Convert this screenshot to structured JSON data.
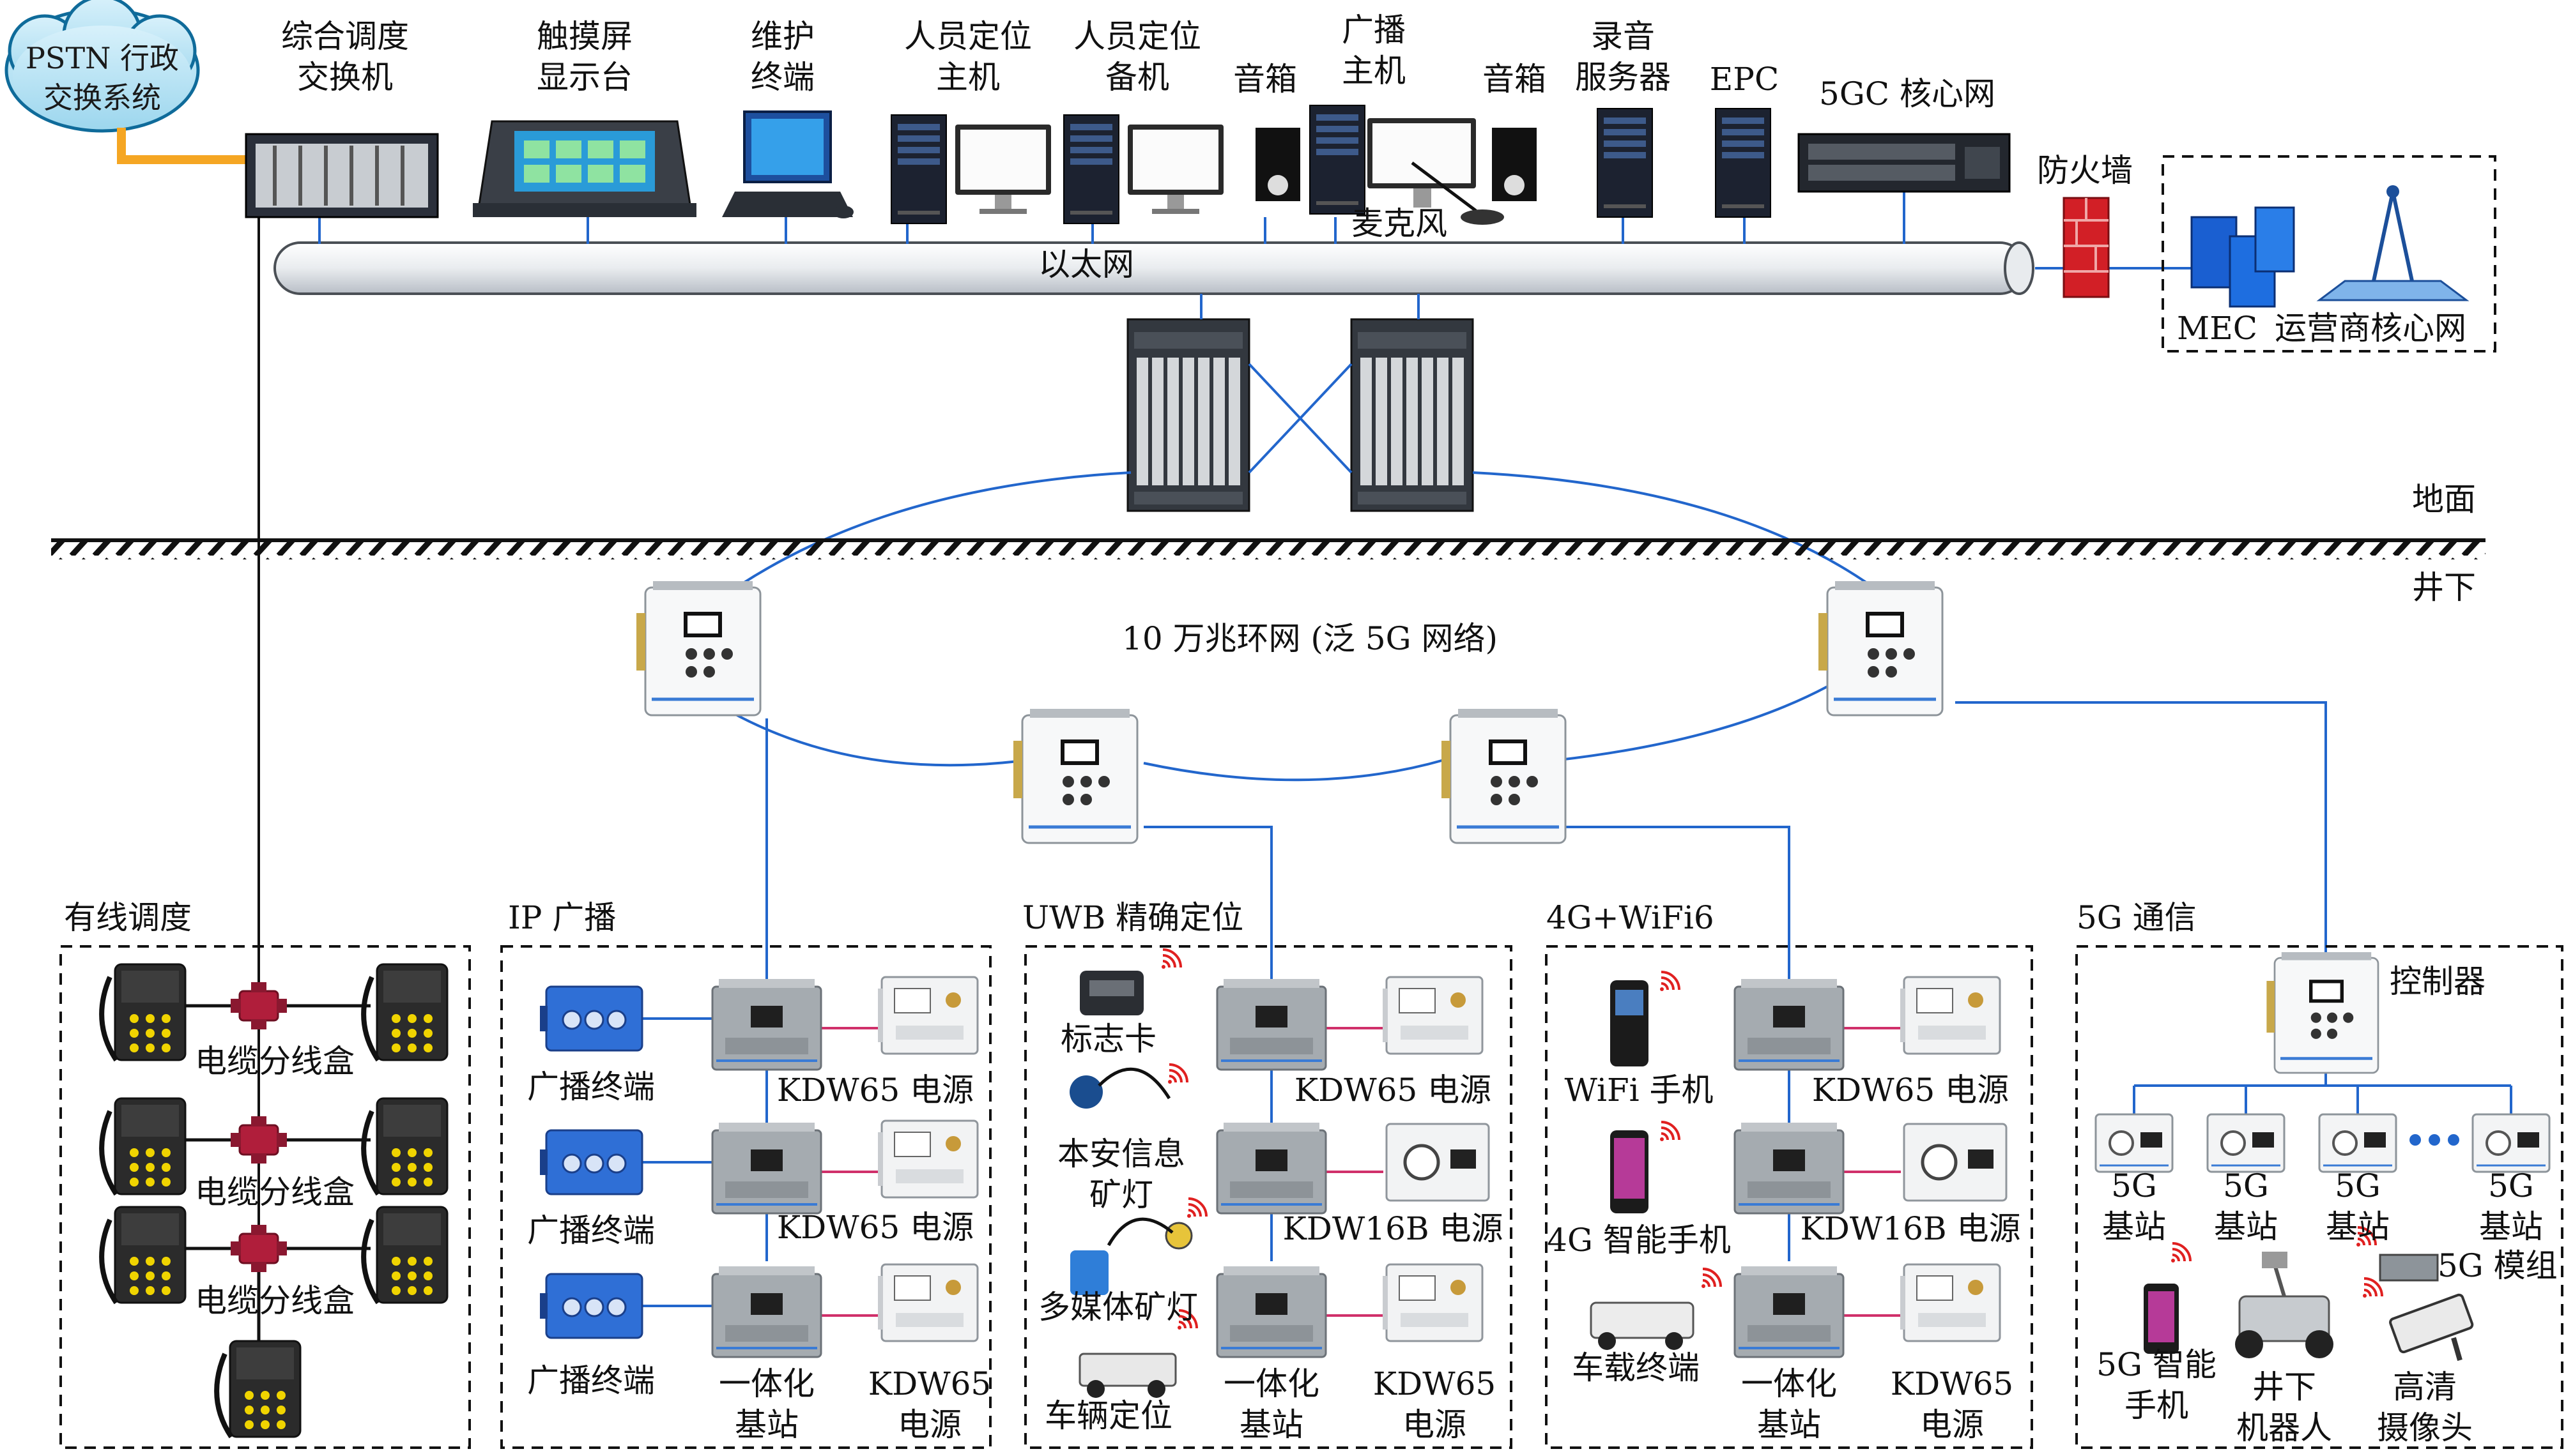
{
  "cloud": {
    "line1": "PSTN 行政",
    "line2": "交换系统"
  },
  "top_devices": [
    {
      "key": "switchboard",
      "line1": "综合调度",
      "line2": "交换机"
    },
    {
      "key": "touchscreen",
      "line1": "触摸屏",
      "line2": "显示台"
    },
    {
      "key": "maintenance",
      "line1": "维护",
      "line2": "终端"
    },
    {
      "key": "pos-main",
      "line1": "人员定位",
      "line2": "主机"
    },
    {
      "key": "pos-backup",
      "line1": "人员定位",
      "line2": "备机"
    },
    {
      "key": "speaker-left",
      "line1": "音箱",
      "line2": ""
    },
    {
      "key": "broadcast-host",
      "line1": "广播",
      "line2": "主机"
    },
    {
      "key": "speaker-right",
      "line1": "音箱",
      "line2": ""
    },
    {
      "key": "recording",
      "line1": "录音",
      "line2": "服务器"
    },
    {
      "key": "epc",
      "line1": "EPC",
      "line2": ""
    },
    {
      "key": "core5gc",
      "line1": "5GC 核心网",
      "line2": ""
    }
  ],
  "labels": {
    "microphone": "麦克风",
    "ethernet": "以太网",
    "firewall": "防火墙",
    "mec": "MEC",
    "operator_core": "运营商核心网",
    "ground": "地面",
    "underground": "井下",
    "ring": "10 万兆环网 (泛 5G 网络)"
  },
  "sections": {
    "wired": {
      "title": "有线调度",
      "box_label": "电缆分线盒"
    },
    "ip_broadcast": {
      "title": "IP 广播",
      "terminal": "广播终端",
      "psu": "KDW65 电源",
      "bottom_station": [
        "一体化",
        "基站"
      ],
      "bottom_psu": [
        "KDW65",
        "电源"
      ]
    },
    "uwb": {
      "title": "UWB 精确定位",
      "tag": "标志卡",
      "lamp1": [
        "本安信息",
        "矿灯"
      ],
      "lamp2": "多媒体矿灯",
      "vehicle": "车辆定位",
      "psu1": "KDW65 电源",
      "psu2": "KDW16B 电源",
      "bottom_station": [
        "一体化",
        "基站"
      ],
      "bottom_psu": [
        "KDW65",
        "电源"
      ]
    },
    "wifi": {
      "title": "4G+WiFi6",
      "phone1": "WiFi 手机",
      "phone2": "4G 智能手机",
      "vehicle": "车载终端",
      "psu1": "KDW65 电源",
      "psu2": "KDW16B 电源",
      "bottom_station": [
        "一体化",
        "基站"
      ],
      "bottom_psu": [
        "KDW65",
        "电源"
      ]
    },
    "g5": {
      "title": "5G 通信",
      "controller": "控制器",
      "bs": [
        "5G",
        "基站"
      ],
      "module": "5G 模组",
      "phone": [
        "5G 智能",
        "手机"
      ],
      "robot": [
        "井下",
        "机器人"
      ],
      "camera": [
        "高清",
        "摄像头"
      ]
    }
  },
  "colors": {
    "line_blue": "#2266cc",
    "line_pink": "#d0306a",
    "line_orange": "#f5a623",
    "device_gray": "#9aa0a6",
    "dark": "#1d2433",
    "wifi_red": "#e02020"
  }
}
